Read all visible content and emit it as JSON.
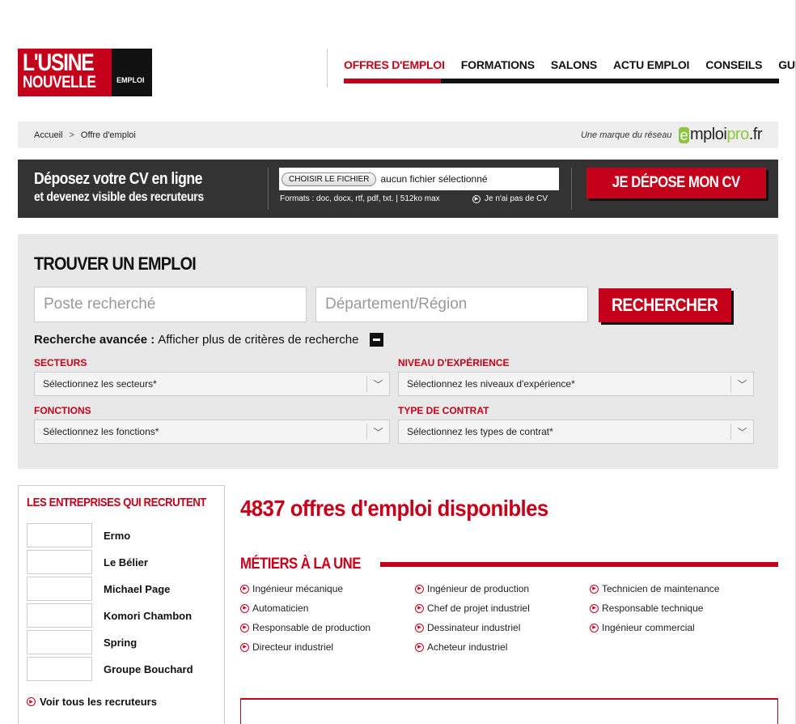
{
  "logo": {
    "line1": "L'USINE",
    "line2": "NOUVELLE",
    "tag": "EMPLOI"
  },
  "nav": {
    "items": [
      "OFFRES D'EMPLOI",
      "FORMATIONS",
      "SALONS",
      "ACTU EMPLOI",
      "CONSEILS",
      "GUIDES"
    ],
    "active_index": 0
  },
  "breadcrumb": {
    "home": "Accueil",
    "separator": ">",
    "current": "Offre d'emploi"
  },
  "brand": {
    "text": "Une marque du réseau",
    "logo_e": "e",
    "logo_mid": "mploi",
    "logo_pro": "pro",
    "logo_fr": ".fr"
  },
  "cv_banner": {
    "title_line1": "Déposez votre CV en ligne",
    "title_line2": "et devenez visible des recruteurs",
    "file_button": "CHOISIR LE FICHIER",
    "file_status": "aucun fichier sélectionné",
    "formats": "Formats : doc, docx, rtf, pdf, txt. | 512ko max",
    "no_cv_link": "Je n'ai pas de CV",
    "submit_button": "JE DÉPOSE MON CV"
  },
  "search": {
    "title": "TROUVER UN EMPLOI",
    "job_placeholder": "Poste recherché",
    "location_placeholder": "Département/Région",
    "button": "RECHERCHER",
    "advanced_label": "Recherche avancée :",
    "advanced_text": "Afficher plus de critères de recherche",
    "filters": {
      "secteurs": {
        "label": "SECTEURS",
        "value": "Sélectionnez les secteurs*"
      },
      "niveau": {
        "label": "NIVEAU D'EXPÉRIENCE",
        "value": "Sélectionnez les niveaux d'expérience*"
      },
      "fonctions": {
        "label": "FONCTIONS",
        "value": "Sélectionnez les fonctions*"
      },
      "contrat": {
        "label": "TYPE DE CONTRAT",
        "value": "Sélectionnez les types de contrat*"
      }
    }
  },
  "companies": {
    "title": "LES ENTREPRISES QUI RECRUTENT",
    "items": [
      "Ermo",
      "Le Bélier",
      "Michael Page",
      "Komori Chambon",
      "Spring",
      "Groupe Bouchard"
    ],
    "see_all": "Voir tous les recruteurs"
  },
  "main": {
    "count_title": "4837 offres d'emploi disponibles",
    "metiers_title": "MÉTIERS À LA UNE",
    "metiers": [
      "Ingénieur mécanique",
      "Ingénieur de production",
      "Technicien de maintenance",
      "Automaticien",
      "Chef de projet industriel",
      "Responsable technique",
      "Responsable de production",
      "Dessinateur industriel",
      "Ingénieur commercial",
      "Directeur industriel",
      "Acheteur industriel"
    ]
  },
  "colors": {
    "accent": "#c4001a",
    "dark": "#333333",
    "panel": "#e8e8e8",
    "brand_green": "#8cc63f"
  }
}
